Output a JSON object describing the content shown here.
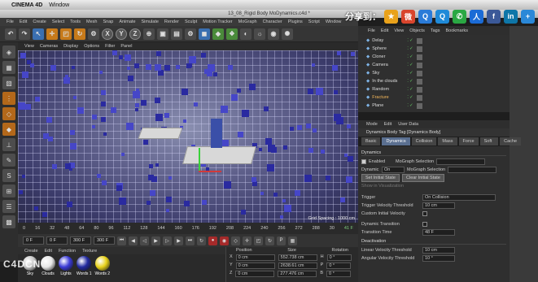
{
  "mac_menu": {
    "app": "CINEMA 4D",
    "window": "Window"
  },
  "share": {
    "label": "分享到：",
    "icons": [
      {
        "name": "favorite-star-icon",
        "glyph": "★",
        "color": "#e9a21b"
      },
      {
        "name": "weibo-icon",
        "glyph": "微",
        "color": "#d9452d"
      },
      {
        "name": "qzone-icon",
        "glyph": "Q",
        "color": "#2a7bd8"
      },
      {
        "name": "qq-icon",
        "glyph": "Q",
        "color": "#1f8ad8"
      },
      {
        "name": "wechat-icon",
        "glyph": "✆",
        "color": "#2aa843"
      },
      {
        "name": "renren-icon",
        "glyph": "人",
        "color": "#1b6bd6"
      },
      {
        "name": "facebook-icon",
        "glyph": "f",
        "color": "#3b5998"
      },
      {
        "name": "linkedin-icon",
        "glyph": "in",
        "color": "#0e76a8"
      },
      {
        "name": "more-icon",
        "glyph": "+",
        "color": "#2a88d8"
      }
    ]
  },
  "window_title": "13_08_Rigid Body MoDynamics.c4d *",
  "menubar": [
    "File",
    "Edit",
    "Create",
    "Select",
    "Tools",
    "Mesh",
    "Snap",
    "Animate",
    "Simulate",
    "Render",
    "Sculpt",
    "Motion Tracker",
    "MoGraph",
    "Character",
    "Plugins",
    "Script",
    "Window"
  ],
  "toolbar": {
    "undo": "↶",
    "redo": "↷",
    "x": "X",
    "y": "Y",
    "z": "Z"
  },
  "viewport": {
    "menu": [
      "View",
      "Cameras",
      "Display",
      "Options",
      "Filter",
      "Panel"
    ],
    "label": "Perspective",
    "grid_spacing": "Grid Spacing : 1000 cm"
  },
  "timeline": {
    "ticks": [
      "0",
      "16",
      "32",
      "48",
      "64",
      "80",
      "96",
      "112",
      "128",
      "144",
      "160",
      "176",
      "192",
      "208",
      "224",
      "240",
      "256",
      "272",
      "288",
      "30"
    ],
    "current": "41 F"
  },
  "transport": {
    "start": "0 F",
    "field2": "0 F",
    "end": "300 F",
    "field4": "300 F"
  },
  "material": {
    "menu": [
      "Create",
      "Edit",
      "Function",
      "Texture"
    ],
    "items": [
      {
        "label": "Sky",
        "color": "#c9c9c9"
      },
      {
        "label": "Clouds",
        "color": "#e8e8e8"
      },
      {
        "label": "Lights",
        "color": "#3b3bd6"
      },
      {
        "label": "Words 1",
        "color": "#222aa0"
      },
      {
        "label": "Words 2",
        "color": "#e8d21a"
      }
    ]
  },
  "coords": {
    "headers": [
      "Position",
      "Size",
      "Rotation"
    ],
    "rows": [
      {
        "axis": "X",
        "pos": "0 cm",
        "size": "552.738 cm",
        "rot_axis": "H",
        "rot": "0 °"
      },
      {
        "axis": "Y",
        "pos": "0 cm",
        "size": "2638.61 cm",
        "rot_axis": "P",
        "rot": "0 °"
      },
      {
        "axis": "Z",
        "pos": "0 cm",
        "size": "277.476 cm",
        "rot_axis": "B",
        "rot": "0 °"
      }
    ]
  },
  "objects": {
    "menu": [
      "File",
      "Edit",
      "View",
      "Objects",
      "Tags",
      "Bookmarks"
    ],
    "rows": [
      {
        "name": "Delay",
        "selected": false
      },
      {
        "name": "Sphere",
        "selected": false
      },
      {
        "name": "Cloner",
        "selected": false
      },
      {
        "name": "Camera",
        "selected": false
      },
      {
        "name": "Sky",
        "selected": false
      },
      {
        "name": "In the clouds",
        "selected": false
      },
      {
        "name": "Random",
        "selected": false
      },
      {
        "name": "Fracture",
        "selected": true
      },
      {
        "name": "Plane",
        "selected": false
      }
    ]
  },
  "attributes": {
    "menu": [
      "Mode",
      "Edit",
      "User Data"
    ],
    "title": "Dynamics Body Tag [Dynamics Body]",
    "tabs": [
      {
        "label": "Basic",
        "active": false
      },
      {
        "label": "Dynamics",
        "active": true
      },
      {
        "label": "Collision",
        "active": false
      },
      {
        "label": "Mass",
        "active": false
      },
      {
        "label": "Force",
        "active": false
      },
      {
        "label": "Soft Body",
        "active": false
      },
      {
        "label": "Cache",
        "active": false
      }
    ],
    "section": "Dynamics",
    "enabled_label": "Enabled",
    "mograph_selection_label": "MoGraph Selection",
    "dynamic_label": "Dynamic",
    "dynamic_value": "On",
    "set_initial": "Set Initial State",
    "clear_initial": "Clear Initial State",
    "show_vis": "Show in Visualization",
    "trigger_label": "Trigger",
    "trigger_value": "On Collision",
    "trigger_vel_label": "Trigger Velocity Threshold",
    "trigger_vel_value": "10 cm",
    "custom_vel_label": "Custom Initial Velocity",
    "dyn_transition_label": "Dynamic Transition",
    "transition_time_label": "Transition Time",
    "transition_time_value": "48 F",
    "deactivation_section": "Deactivation",
    "linear_label": "Linear Velocity Threshold",
    "linear_value": "10 cm",
    "angular_label": "Angular Velocity Threshold",
    "angular_value": "10 °"
  },
  "watermark": "C4DCN"
}
